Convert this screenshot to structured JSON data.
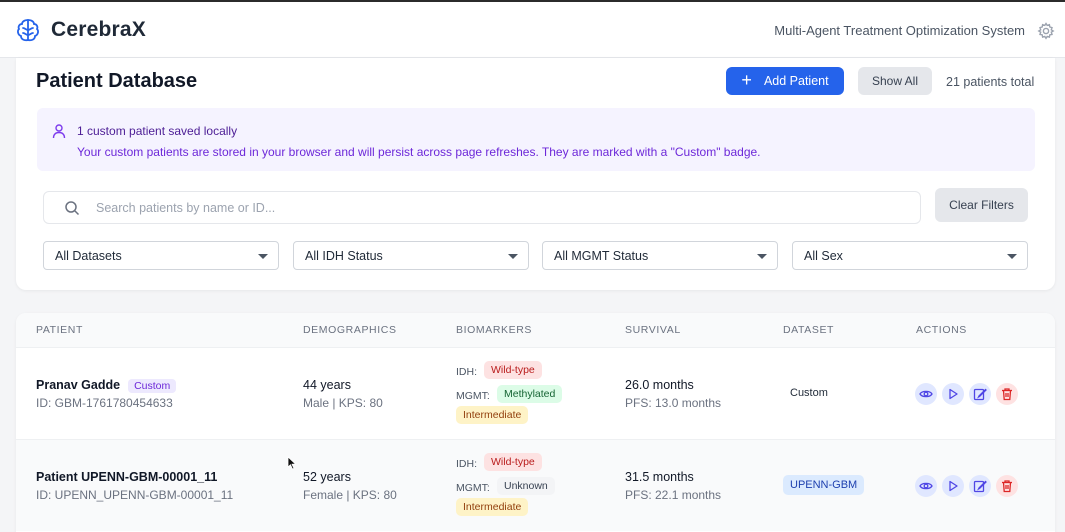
{
  "header": {
    "brand": "CerebraX",
    "subtitle": "Multi-Agent Treatment Optimization System"
  },
  "toolbar": {
    "title": "Patient Database",
    "add_label": "Add Patient",
    "show_all_label": "Show All",
    "total": "21 patients total"
  },
  "notice": {
    "title": "1 custom patient saved locally",
    "body": "Your custom patients are stored in your browser and will persist across page refreshes. They are marked with a \"Custom\" badge."
  },
  "search": {
    "placeholder": "Search patients by name or ID...",
    "value": "",
    "clear_label": "Clear Filters"
  },
  "filters": [
    "All Datasets",
    "All IDH Status",
    "All MGMT Status",
    "All Sex"
  ],
  "table": {
    "headers": [
      "PATIENT",
      "DEMOGRAPHICS",
      "BIOMARKERS",
      "SURVIVAL",
      "DATASET",
      "ACTIONS"
    ],
    "rows": [
      {
        "name": "Pranav Gadde",
        "badge": "Custom",
        "id": "ID: GBM-1761780454633",
        "age": "44 years",
        "sex_kps": "Male | KPS: 80",
        "idh_label": "IDH:",
        "idh": "Wild-type",
        "mgmt_label": "MGMT:",
        "mgmt": "Methylated",
        "grade": "Intermediate",
        "survival": "26.0 months",
        "pfs": "PFS: 13.0 months",
        "dataset": "Custom"
      },
      {
        "name": "Patient UPENN-GBM-00001_11",
        "badge": "",
        "id": "ID: UPENN_UPENN-GBM-00001_11",
        "age": "52 years",
        "sex_kps": "Female | KPS: 80",
        "idh_label": "IDH:",
        "idh": "Wild-type",
        "mgmt_label": "MGMT:",
        "mgmt": "Unknown",
        "grade": "Intermediate",
        "survival": "31.5 months",
        "pfs": "PFS: 22.1 months",
        "dataset": "UPENN-GBM"
      }
    ]
  },
  "colors": {
    "accent": "#2563eb",
    "danger": "#dc2626",
    "notice_bg": "#f5f3ff"
  },
  "icons": [
    "brain-icon",
    "gear-icon",
    "plus-icon",
    "user-icon",
    "search-icon",
    "eye-icon",
    "play-icon",
    "edit-icon",
    "trash-icon",
    "mouse-cursor-icon"
  ]
}
